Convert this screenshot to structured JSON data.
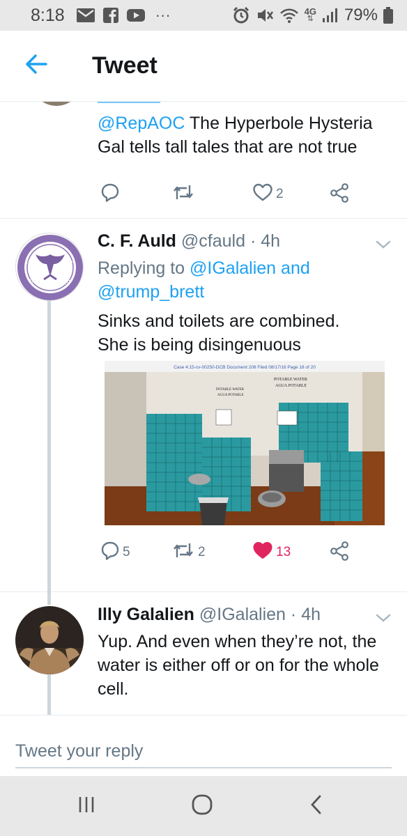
{
  "status_bar": {
    "time": "8:18",
    "dots": "···",
    "network": "4G",
    "battery": "79%",
    "icons": [
      "mail-icon",
      "facebook-icon",
      "youtube-icon",
      "alarm-icon",
      "mute-icon",
      "wifi-icon",
      "signal-icon",
      "battery-icon"
    ]
  },
  "header": {
    "title": "Tweet",
    "back_icon": "back-arrow-icon"
  },
  "colors": {
    "accent": "#1da1f2",
    "like": "#e0245e",
    "muted": "#657786",
    "divider": "#e6ecf0"
  },
  "tweets": [
    {
      "mention": "@RepAOC",
      "text": " The Hyperbole Hysteria Gal tells tall tales that are not true",
      "reply_count": "",
      "retweet_count": "",
      "like_count": "2"
    },
    {
      "name": "C. F. Auld",
      "handle": "@cfauld",
      "time": "· 4h",
      "replying_prefix": "Replying to ",
      "replying_to_1": "@IGalalien",
      "replying_and": " and",
      "replying_to_2": "@trump_brett",
      "text_line1": "Sinks and toilets are combined.",
      "text_line2": "She is being disingenuous",
      "media": {
        "header": "Case 4:15-cv-00250-DCB   Document 208   Filed 08/17/16   Page 18 of 20",
        "sign_left_1": "POTABLE WATER",
        "sign_left_2": "AGUA POTABLE",
        "sign_right_1": "POTABLE WATER",
        "sign_right_2": "AGUA POTABLE"
      },
      "reply_count": "5",
      "retweet_count": "2",
      "like_count": "13",
      "liked": true
    },
    {
      "name": "Illy Galalien",
      "handle": "@IGalalien",
      "time": "· 4h",
      "text": "Yup. And even when they’re not, the water is either off or on for the whole cell."
    }
  ],
  "reply_bar": {
    "placeholder": "Tweet your reply"
  },
  "nav_bar": {
    "icons": [
      "recent-apps-icon",
      "home-icon",
      "back-icon"
    ]
  }
}
